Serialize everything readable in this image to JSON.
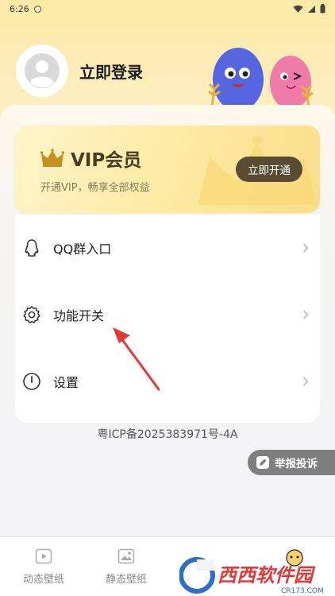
{
  "status_bar": {
    "time": "6:26"
  },
  "profile": {
    "login_label": "立即登录"
  },
  "vip": {
    "title": "VIP会员",
    "subtitle": "开通VIP，畅享全部权益",
    "button_label": "立即开通"
  },
  "menu": {
    "items": [
      {
        "label": "QQ群入口",
        "icon": "qq-icon"
      },
      {
        "label": "功能开关",
        "icon": "gear-icon"
      },
      {
        "label": "设置",
        "icon": "power-icon"
      }
    ]
  },
  "icp": "粤ICP备2025383971号-4A",
  "report": {
    "label": "举报投诉"
  },
  "tabs": [
    {
      "label": "动态壁纸",
      "icon": "play-video-icon"
    },
    {
      "label": "静态壁纸",
      "icon": "image-icon"
    }
  ],
  "watermark": {
    "text": "西西软件园",
    "subtext": "CR173.COM"
  },
  "colors": {
    "top_gradient": "#fbe9a6",
    "vip_button": "#5a4c33",
    "report_button": "#7e7e7e",
    "annotation_arrow": "#e53935"
  }
}
